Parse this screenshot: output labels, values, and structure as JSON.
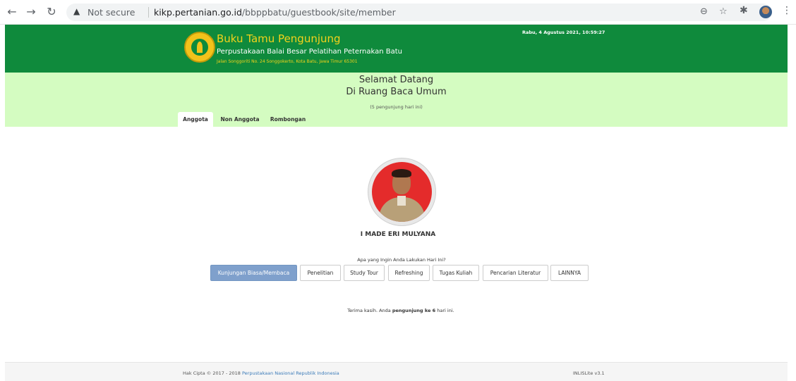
{
  "browser": {
    "security_label": "Not secure",
    "url_host": "kikp.pertanian.go.id",
    "url_path": "/bbppbatu/guestbook/site/member"
  },
  "header": {
    "title": "Buku Tamu Pengunjung",
    "subtitle": "Perpustakaan Balai Besar Pelatihan Peternakan Batu",
    "address": "Jalan Songgoriti No. 24 Songgokerto, Kota Batu, Jawa Timur 65301",
    "datetime": "Rabu, 4 Agustus 2021, 10:59:27"
  },
  "welcome": {
    "line1": "Selamat Datang",
    "line2": "Di Ruang Baca Umum",
    "visitor_count": "(5 pengunjung hari ini)"
  },
  "tabs": [
    {
      "label": "Anggota",
      "active": true
    },
    {
      "label": "Non Anggota",
      "active": false
    },
    {
      "label": "Rombongan",
      "active": false
    }
  ],
  "member": {
    "name": "I MADE ERI MULYANA"
  },
  "activity": {
    "question": "Apa yang Ingin Anda Lakukan Hari Ini?",
    "options": [
      "Kunjungan Biasa/Membaca",
      "Penelitian",
      "Study Tour",
      "Refreshing",
      "Tugas Kuliah",
      "Pencarian Literatur",
      "LAINNYA"
    ]
  },
  "thanks": {
    "before": "Terima kasih. Anda ",
    "bold": "pengunjung ke 6",
    "after": " hari ini."
  },
  "footer": {
    "copyright_prefix": "Hak Cipta © 2017 - 2018 ",
    "copyright_link": "Perpustakaan Nasional Republik Indonesia",
    "version": "INLISLite v3.1"
  },
  "colors": {
    "header_green": "#0f8a3c",
    "welcome_green": "#d4fcc1",
    "title_yellow": "#f3d21b",
    "primary_button": "#7fa0cc",
    "photo_background": "#e42b2b"
  },
  "icons": [
    "back-icon",
    "forward-icon",
    "reload-icon",
    "warning-icon",
    "zoom-icon",
    "star-icon",
    "extensions-icon",
    "profile-avatar",
    "menu-icon",
    "library-logo"
  ]
}
